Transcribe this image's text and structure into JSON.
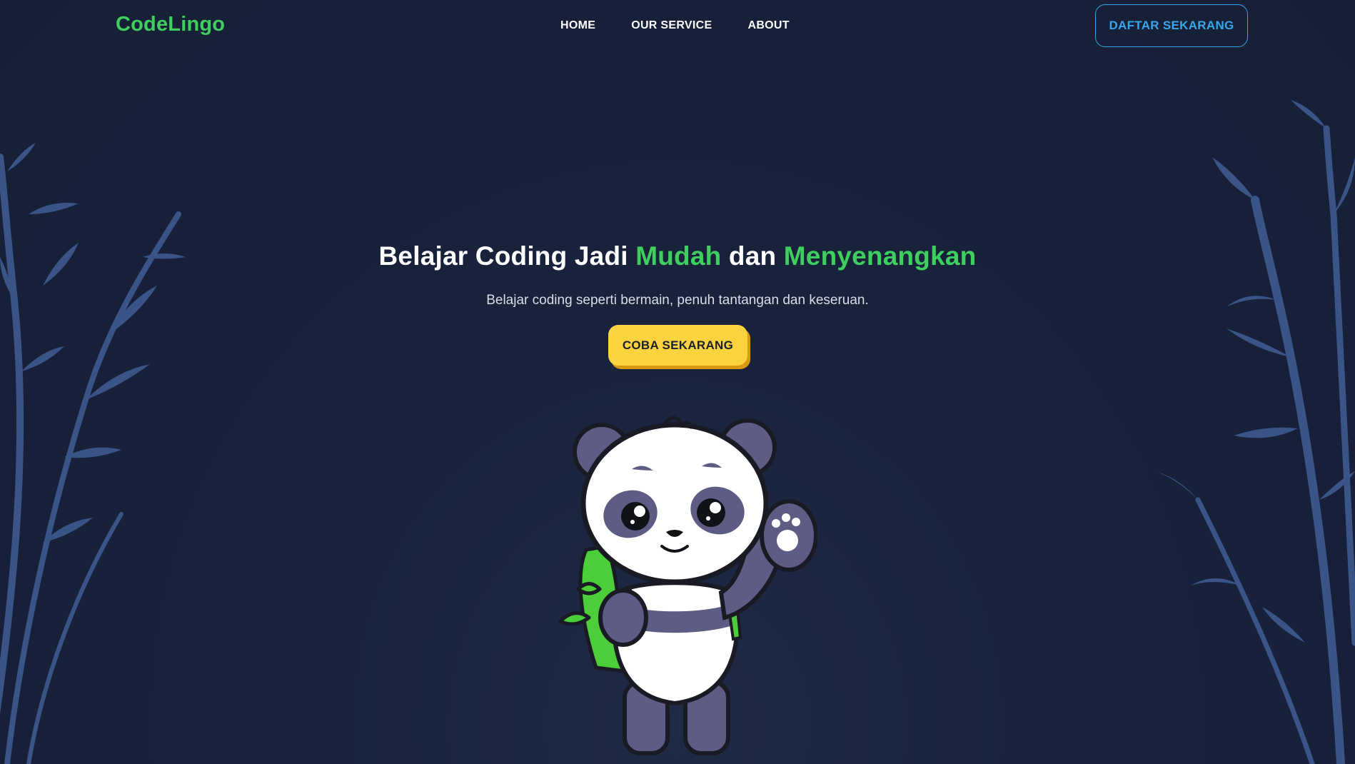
{
  "nav": {
    "logo": "CodeLingo",
    "menu": [
      "HOME",
      "OUR SERVICE",
      "ABOUT"
    ],
    "signup_label": "DAFTAR SEKARANG"
  },
  "hero": {
    "title_part1": "Belajar Coding Jadi ",
    "title_highlight1": "Mudah",
    "title_part2": " dan ",
    "title_highlight2": "Menyenangkan",
    "subtitle": "Belajar coding seperti bermain, penuh tantangan dan keseruan.",
    "cta_label": "COBA SEKARANG"
  },
  "colors": {
    "background": "#18223b",
    "accent_green": "#3fcf5e",
    "outline_blue": "#38a6ea",
    "cta_yellow": "#fbd33f",
    "bamboo": "#3a5487"
  },
  "illustration": {
    "icon": "panda-mascot-icon",
    "left_decoration": "bamboo-icon",
    "right_decoration": "bamboo-icon"
  }
}
